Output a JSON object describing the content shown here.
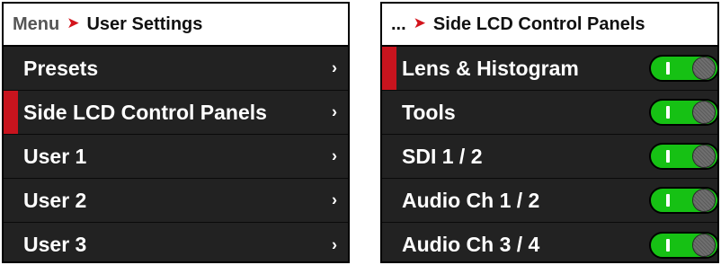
{
  "left_panel": {
    "breadcrumb_parent": "Menu",
    "breadcrumb_sep": "➤",
    "breadcrumb_current": "User Settings",
    "items": [
      {
        "label": "Presets",
        "chevron": "›"
      },
      {
        "label": "Side LCD Control Panels",
        "chevron": "›",
        "selected": true
      },
      {
        "label": "User 1",
        "chevron": "›"
      },
      {
        "label": "User 2",
        "chevron": "›"
      },
      {
        "label": "User 3",
        "chevron": "›"
      }
    ]
  },
  "right_panel": {
    "breadcrumb_parent": "...",
    "breadcrumb_sep": "➤",
    "breadcrumb_current": "Side LCD Control Panels",
    "items": [
      {
        "label": "Lens & Histogram",
        "toggle_on": true,
        "selected": true
      },
      {
        "label": "Tools",
        "toggle_on": true
      },
      {
        "label": "SDI 1 / 2",
        "toggle_on": true
      },
      {
        "label": "Audio Ch 1 / 2",
        "toggle_on": true
      },
      {
        "label": "Audio Ch 3 / 4",
        "toggle_on": true
      }
    ]
  },
  "colors": {
    "accent_red": "#c8141e",
    "toggle_green": "#16c114",
    "row_bg": "#222222",
    "header_bg": "#ffffff"
  }
}
